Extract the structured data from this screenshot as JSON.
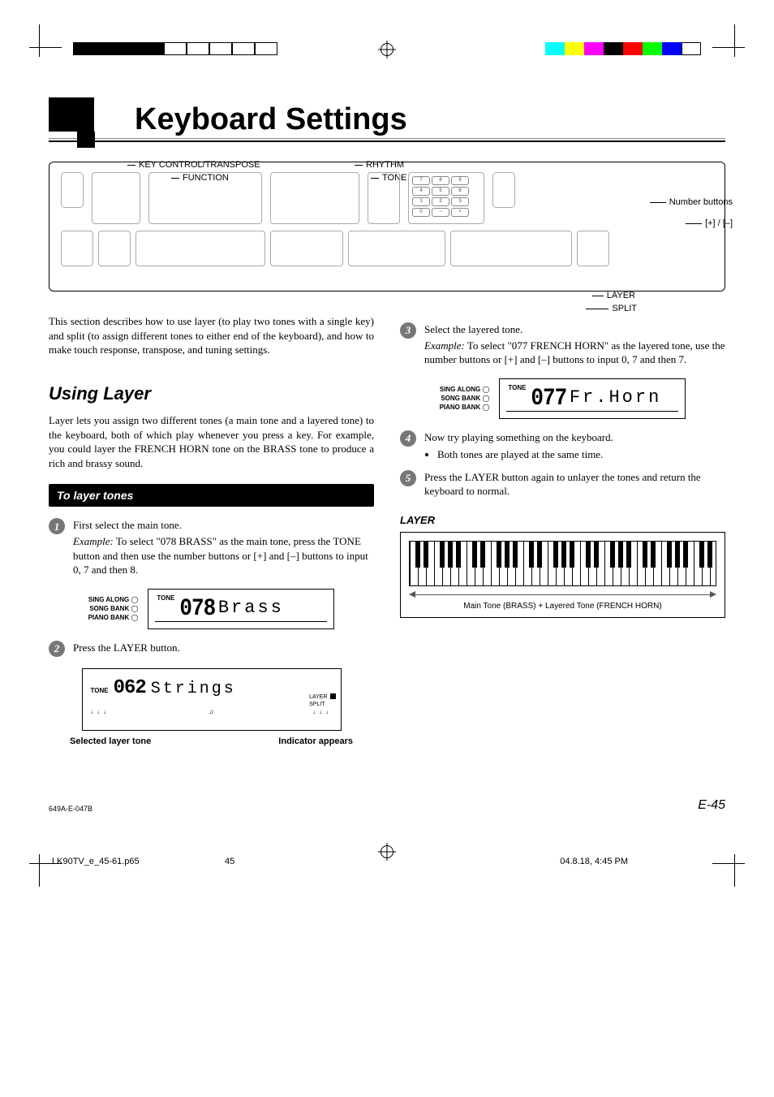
{
  "title": "Keyboard Settings",
  "diagram": {
    "labels": {
      "key_control": "KEY CONTROL/TRANSPOSE",
      "function": "FUNCTION",
      "rhythm": "RHYTHM",
      "tone": "TONE",
      "number_buttons": "Number buttons",
      "plus_minus": "[+] / [–]",
      "layer": "LAYER",
      "split": "SPLIT"
    }
  },
  "intro": "This section describes how to use layer (to play two tones with a single key) and split (to assign different tones to either end of the keyboard), and how to make touch response, transpose, and tuning settings.",
  "using_layer": {
    "heading": "Using Layer",
    "body": "Layer lets you assign two different tones (a main tone and a layered tone) to the keyboard, both of which play whenever you press a key. For example, you could layer the FRENCH HORN tone on the BRASS tone to produce a rich and brassy sound."
  },
  "to_layer": {
    "bar": "To layer tones",
    "step1": {
      "text": "First select the main tone.",
      "example_label": "Example:",
      "example": "To select \"078 BRASS\" as the main tone, press the TONE button and then use the number buttons or [+] and [–] buttons to input 0, 7 and then 8."
    },
    "lcd1": {
      "tone": "TONE",
      "num": "078",
      "name": "Brass",
      "modes": [
        "SING ALONG",
        "SONG BANK",
        "PIANO BANK"
      ]
    },
    "step2": {
      "text": "Press the LAYER button."
    },
    "lcd2": {
      "tone": "TONE",
      "num": "062",
      "name": "Strings",
      "side": [
        "LAYER",
        "SPLIT"
      ]
    },
    "cap_left": "Selected layer tone",
    "cap_right": "Indicator appears",
    "step3": {
      "text": "Select the layered tone.",
      "example_label": "Example:",
      "example": "To select \"077 FRENCH HORN\" as the layered tone, use the number buttons or [+] and [–] buttons to input 0, 7 and then 7."
    },
    "lcd3": {
      "tone": "TONE",
      "num": "077",
      "name": "Fr.Horn",
      "modes": [
        "SING ALONG",
        "SONG BANK",
        "PIANO BANK"
      ]
    },
    "step4": {
      "text": "Now try playing something on the keyboard.",
      "bullet": "Both tones are played at the same time."
    },
    "step5": {
      "text": "Press the LAYER button again to unlayer the tones and return the keyboard to normal."
    }
  },
  "layer_fig": {
    "heading": "LAYER",
    "caption": "Main Tone (BRASS) + Layered Tone (FRENCH HORN)"
  },
  "footer": {
    "code": "649A-E-047B",
    "page": "E-45",
    "file": "LK90TV_e_45-61.p65",
    "sheet": "45",
    "timestamp": "04.8.18, 4:45 PM"
  }
}
